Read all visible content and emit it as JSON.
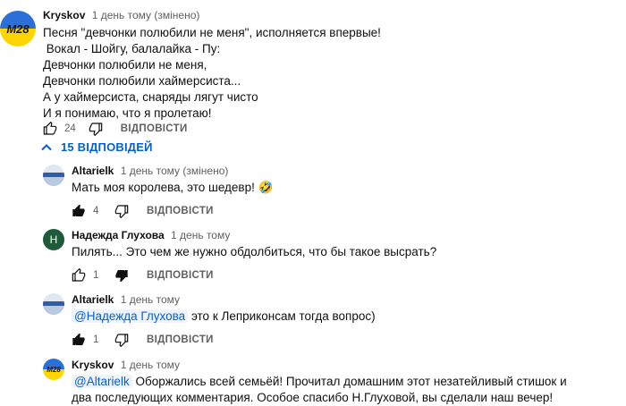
{
  "top_comment": {
    "author": "Kryskov",
    "meta": "1 день тому (змінено)",
    "avatar_text": "M28",
    "lines": [
      "Песня \"девчонки полюбили не меня\", исполняется впервые!",
      " Вокал - Шойгу, балалайка - Пу:",
      "Девчонки полюбили не меня,",
      "Девчонки полюбили хаймерсиста...",
      "А у хаймерсиста, снаряды лягут чисто",
      "И я понимаю, что я пролетаю!"
    ],
    "likes": "24",
    "reply_label": "ВІДПОВІСТИ"
  },
  "replies_toggle": {
    "label": "15 ВІДПОВІДЕЙ"
  },
  "replies": [
    {
      "author": "Altarielk",
      "meta": "1 день тому (змінено)",
      "text": "Мать моя королева, это шедевр! 🤣",
      "likes": "4",
      "reply_label": "ВІДПОВІСТИ"
    },
    {
      "author": "Надежда Глухова",
      "meta": "1 день тому",
      "avatar_letter": "Н",
      "text": "Пилять... Это чем же нужно обдолбиться, что бы такое высрать?",
      "likes": "1",
      "reply_label": "ВІДПОВІСТИ"
    },
    {
      "author": "Altarielk",
      "meta": "1 день тому",
      "mention": "@Надежда Глухова",
      "text": " это к Леприконсам тогда вопрос)",
      "likes": "1",
      "reply_label": "ВІДПОВІСТИ"
    },
    {
      "author": "Kryskov",
      "meta": "1 день тому",
      "avatar_text": "M28",
      "mention": "@Altarielk",
      "text": " Оборжались всей семьёй! Прочитал домашним этот незатейливый стишок и",
      "text2": "два последующих комментария. Особое спасибо Н.Глуховой, вы сделали наш вечер!"
    }
  ],
  "colors": {
    "link": "#065fd4",
    "meta": "#606060",
    "avatar_green": "#1e5b3a",
    "m28_yellow": "#ffd500",
    "m28_blue": "#2b6fd8"
  }
}
